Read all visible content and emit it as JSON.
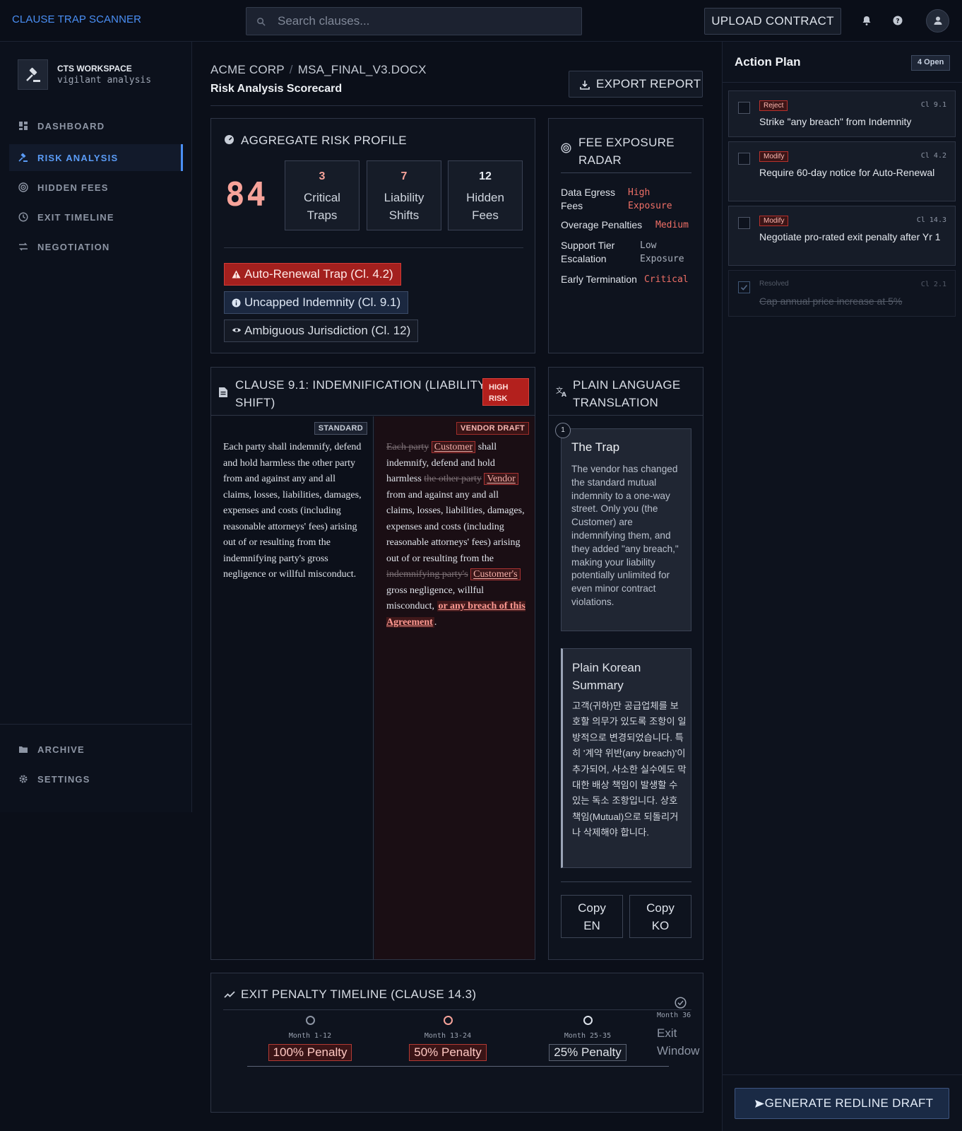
{
  "app": {
    "brand": "CLAUSE TRAP SCANNER",
    "upload_label": "UPLOAD CONTRACT",
    "search_placeholder": "Search clauses..."
  },
  "sidebar": {
    "workspace_title": "CTS WORKSPACE",
    "workspace_sub": "vigilant analysis",
    "nav": [
      {
        "label": "DASHBOARD",
        "icon": "grid-icon"
      },
      {
        "label": "RISK ANALYSIS",
        "icon": "gavel-icon",
        "active": true
      },
      {
        "label": "HIDDEN FEES",
        "icon": "target-icon"
      },
      {
        "label": "EXIT TIMELINE",
        "icon": "clock-icon"
      },
      {
        "label": "NEGOTIATION",
        "icon": "swap-icon"
      }
    ],
    "footer": [
      {
        "label": "ARCHIVE",
        "icon": "folder-icon"
      },
      {
        "label": "SETTINGS",
        "icon": "gear-icon"
      }
    ]
  },
  "header": {
    "company": "ACME CORP",
    "file": "MSA_FINAL_V3.DOCX",
    "subtitle": "Risk Analysis Scorecard",
    "export_label": "EXPORT REPORT"
  },
  "aggregate": {
    "title": "AGGREGATE RISK PROFILE",
    "score": "84",
    "stats": [
      {
        "value": "3",
        "line1": "Critical",
        "line2": "Traps",
        "color": "#f7a39a"
      },
      {
        "value": "7",
        "line1": "Liability",
        "line2": "Shifts",
        "color": "#f7a39a"
      },
      {
        "value": "12",
        "line1": "Hidden",
        "line2": "Fees",
        "color": "#e6eaf0"
      }
    ],
    "tags": [
      {
        "label": "Auto-Renewal Trap (Cl. 4.2)",
        "kind": "red",
        "icon": "warning-icon"
      },
      {
        "label": "Uncapped Indemnity (Cl. 9.1)",
        "kind": "blue",
        "icon": "info-icon"
      },
      {
        "label": "Ambiguous Jurisdiction (Cl. 12)",
        "kind": "gray",
        "icon": "eye-icon"
      }
    ]
  },
  "fees": {
    "title1": "FEE EXPOSURE",
    "title2": "RADAR",
    "rows": [
      {
        "k1": "Data Egress",
        "k2": "Fees",
        "v1": "High",
        "v2": "Exposure",
        "color": "#ef6f66"
      },
      {
        "k1": "Overage Penalties",
        "k2": "",
        "v1": "Medium",
        "v2": "",
        "color": "#ef6f66"
      },
      {
        "k1": "Support Tier",
        "k2": "Escalation",
        "v1": "Low",
        "v2": "Exposure",
        "color": "#a9b0bc"
      },
      {
        "k1": "Early Termination",
        "k2": "",
        "v1": "Critical",
        "v2": "",
        "color": "#ef6f66"
      }
    ]
  },
  "clause": {
    "title1": "CLAUSE 9.1: INDEMNIFICATION (LIABILITY",
    "title2": "SHIFT)",
    "badge1": "HIGH",
    "badge2": "RISK",
    "std_label": "STANDARD",
    "vendor_label": "VENDOR DRAFT",
    "standard_text": "Each party shall indemnify, defend and hold harmless the other party from and against any and all claims, losses, liabilities, damages, expenses and costs (including reasonable attorneys' fees) arising out of or resulting from the indemnifying party's gross negligence or willful misconduct.",
    "v_del1": "Each party",
    "v_ins1": "Customer",
    "v_t1": "shall indemnify, defend and hold harmless",
    "v_del2": "the other party",
    "v_ins2": "Vendor",
    "v_t2": "from and against any and all claims, losses, liabilities, damages, expenses and costs (including reasonable attorneys' fees) arising out of or resulting from the",
    "v_del3": "indemnifying party's",
    "v_ins3": "Customer's",
    "v_t3": "gross negligence, willful misconduct,",
    "v_add": "or any breach of this Agreement",
    "v_end": "."
  },
  "plain": {
    "title1": "PLAIN LANGUAGE",
    "title2": "TRANSLATION",
    "step": "1",
    "trap_title": "The Trap",
    "trap_body": "The vendor has changed the standard mutual indemnity to a one-way street. Only you (the Customer) are indemnifying them, and they added \"any breach,\" making your liability potentially unlimited for even minor contract violations.",
    "kor_title": "Plain Korean Summary",
    "kor_body": "고객(귀하)만 공급업체를 보호할 의무가 있도록 조항이 일방적으로 변경되었습니다. 특히 '계약 위반(any breach)'이 추가되어, 사소한 실수에도 막대한 배상 책임이 발생할 수 있는 독소 조항입니다. 상호 책임(Mutual)으로 되돌리거나 삭제해야 합니다.",
    "copy_en1": "Copy",
    "copy_en2": "EN",
    "copy_ko1": "Copy",
    "copy_ko2": "KO"
  },
  "exit": {
    "title": "EXIT PENALTY TIMELINE (CLAUSE 14.3)",
    "stages": [
      {
        "month": "Month 1-12",
        "penalty": "100% Penalty"
      },
      {
        "month": "Month 13-24",
        "penalty": "50% Penalty"
      },
      {
        "month": "Month 25-35",
        "penalty": "25% Penalty"
      }
    ],
    "final_month": "Month 36",
    "final_label1": "Exit",
    "final_label2": "Window"
  },
  "action_plan": {
    "title": "Action Plan",
    "open_badge": "4 Open",
    "tasks": [
      {
        "label": "Reject",
        "clause": "Cl 9.1",
        "text": "Strike \"any breach\" from Indemnity"
      },
      {
        "label": "Modify",
        "clause": "Cl 4.2",
        "text": "Require 60-day notice for Auto-Renewal"
      },
      {
        "label": "Modify",
        "clause": "Cl 14.3",
        "text": "Negotiate pro-rated exit penalty after Yr 1"
      },
      {
        "label": "Resolved",
        "clause": "Cl 2.1",
        "text": "Cap annual price increase at 5%"
      }
    ],
    "generate_label": "GENERATE REDLINE DRAFT"
  }
}
